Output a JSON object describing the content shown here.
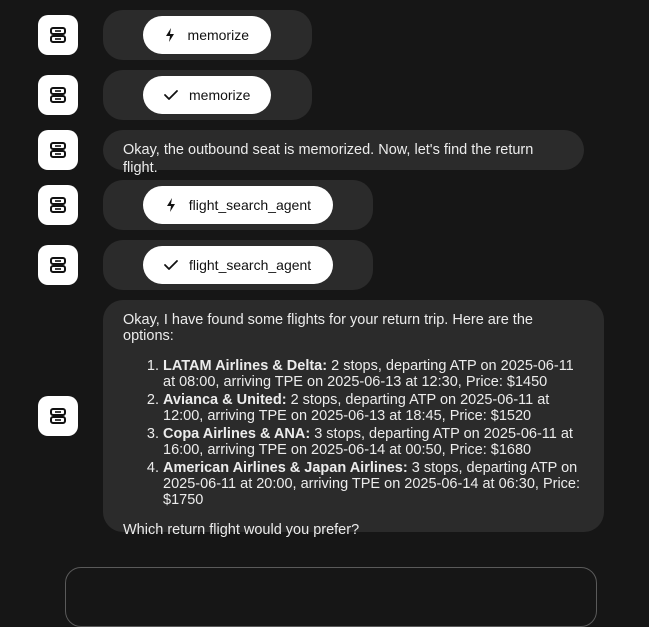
{
  "messages": [
    {
      "type": "tool",
      "status": "running",
      "icon": "lightning-icon",
      "label": "memorize"
    },
    {
      "type": "tool",
      "status": "done",
      "icon": "check-icon",
      "label": "memorize"
    },
    {
      "type": "text",
      "text": "Okay, the outbound seat is memorized. Now, let's find the return flight."
    },
    {
      "type": "tool",
      "status": "running",
      "icon": "lightning-icon",
      "label": "flight_search_agent"
    },
    {
      "type": "tool",
      "status": "done",
      "icon": "check-icon",
      "label": "flight_search_agent"
    },
    {
      "type": "list",
      "intro": "Okay, I have found some flights for your return trip. Here are the options:",
      "options": [
        {
          "airline": "LATAM Airlines & Delta:",
          "details": " 2 stops, departing ATP on 2025-06-11 at 08:00, arriving TPE on 2025-06-13 at 12:30, Price: $1450"
        },
        {
          "airline": "Avianca & United:",
          "details": " 2 stops, departing ATP on 2025-06-11 at 12:00, arriving TPE on 2025-06-13 at 18:45, Price: $1520"
        },
        {
          "airline": "Copa Airlines & ANA:",
          "details": " 3 stops, departing ATP on 2025-06-11 at 16:00, arriving TPE on 2025-06-14 at 00:50, Price: $1680"
        },
        {
          "airline": "American Airlines & Japan Airlines:",
          "details": " 3 stops, departing ATP on 2025-06-11 at 20:00, arriving TPE on 2025-06-14 at 06:30, Price: $1750"
        }
      ],
      "outro": "Which return flight would you prefer?"
    }
  ],
  "composer": {
    "placeholder": ""
  }
}
